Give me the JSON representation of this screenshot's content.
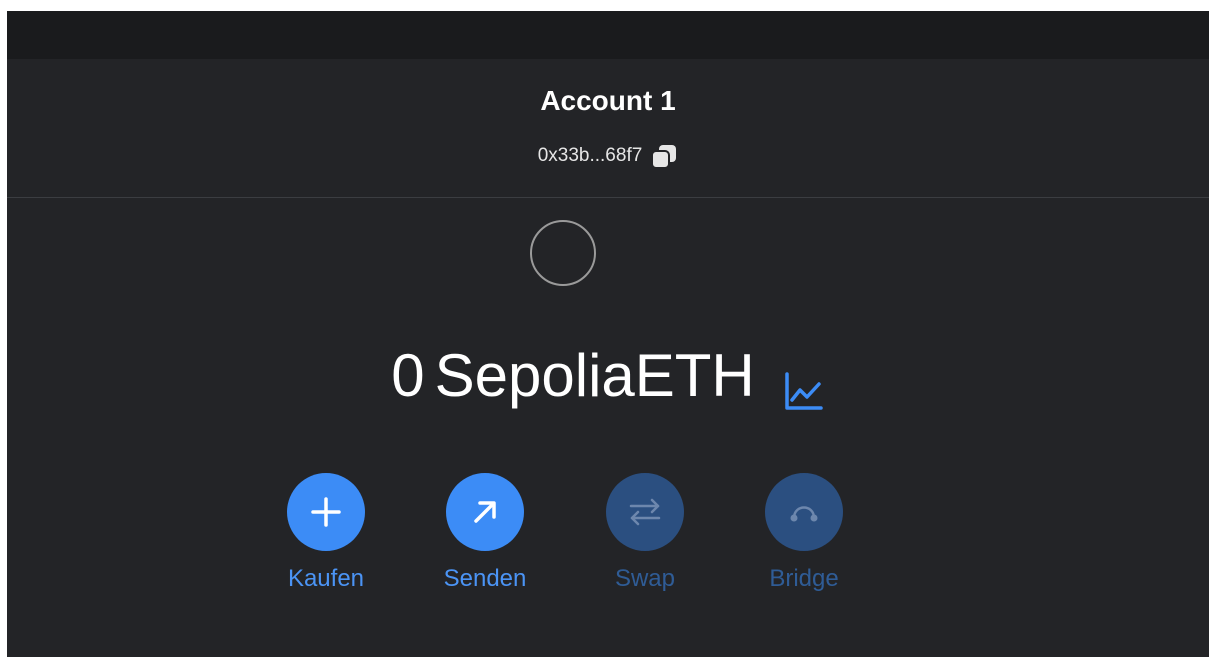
{
  "account": {
    "name": "Account 1",
    "address": "0x33b...68f7"
  },
  "balance": {
    "amount": "0",
    "unit": "SepoliaETH"
  },
  "actions": [
    {
      "label": "Kaufen",
      "icon": "plus-icon",
      "enabled": true
    },
    {
      "label": "Senden",
      "icon": "arrow-up-right-icon",
      "enabled": true
    },
    {
      "label": "Swap",
      "icon": "swap-arrows-icon",
      "enabled": false
    },
    {
      "label": "Bridge",
      "icon": "bridge-icon",
      "enabled": false
    }
  ],
  "colors": {
    "background": "#232427",
    "topbar": "#1a1b1d",
    "accent": "#3c8cf6",
    "accent_disabled": "#2b4f80",
    "text": "#ffffff"
  }
}
